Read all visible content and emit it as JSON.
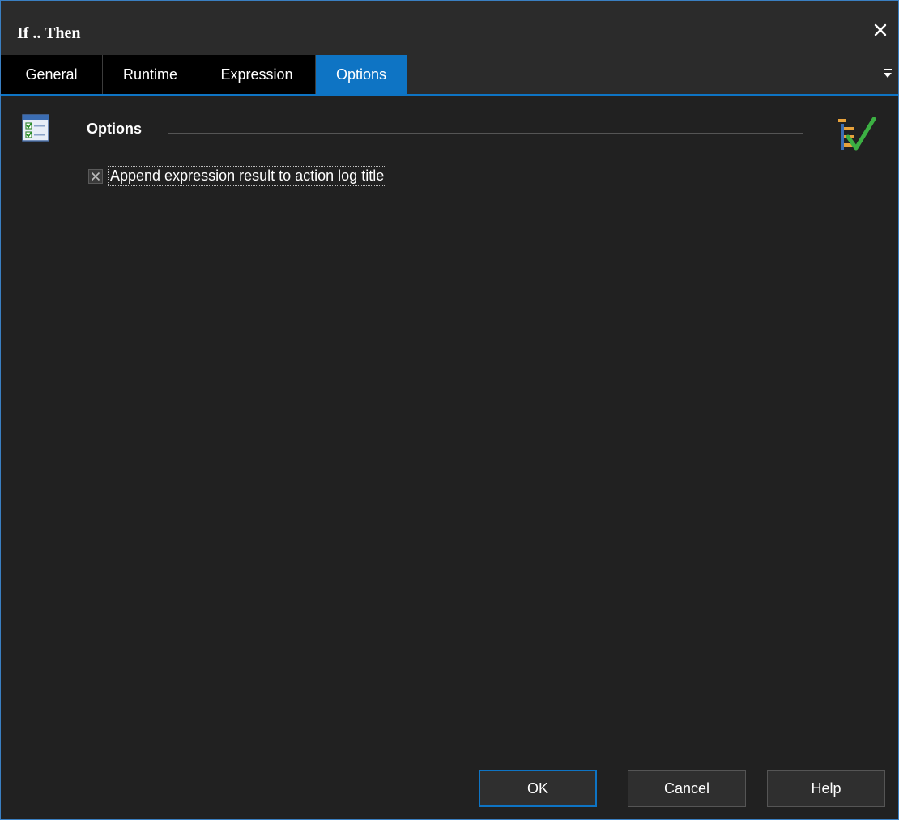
{
  "window": {
    "title": "If .. Then",
    "close_icon": "close-icon"
  },
  "tabs": [
    {
      "label": "General",
      "active": false
    },
    {
      "label": "Runtime",
      "active": false
    },
    {
      "label": "Expression",
      "active": false
    },
    {
      "label": "Options",
      "active": true
    }
  ],
  "tab_menu_icon": "overflow-menu-icon",
  "group": {
    "title": "Options",
    "icon": "checklist-form-icon",
    "right_icon": "options-check-icon"
  },
  "checkbox": {
    "label": "Append expression result to action log title",
    "checked": true
  },
  "buttons": {
    "ok": "OK",
    "cancel": "Cancel",
    "help": "Help"
  },
  "colors": {
    "accent": "#0e74c4",
    "background": "#212121",
    "titlebar": "#2b2b2b",
    "text": "#ffffff"
  }
}
